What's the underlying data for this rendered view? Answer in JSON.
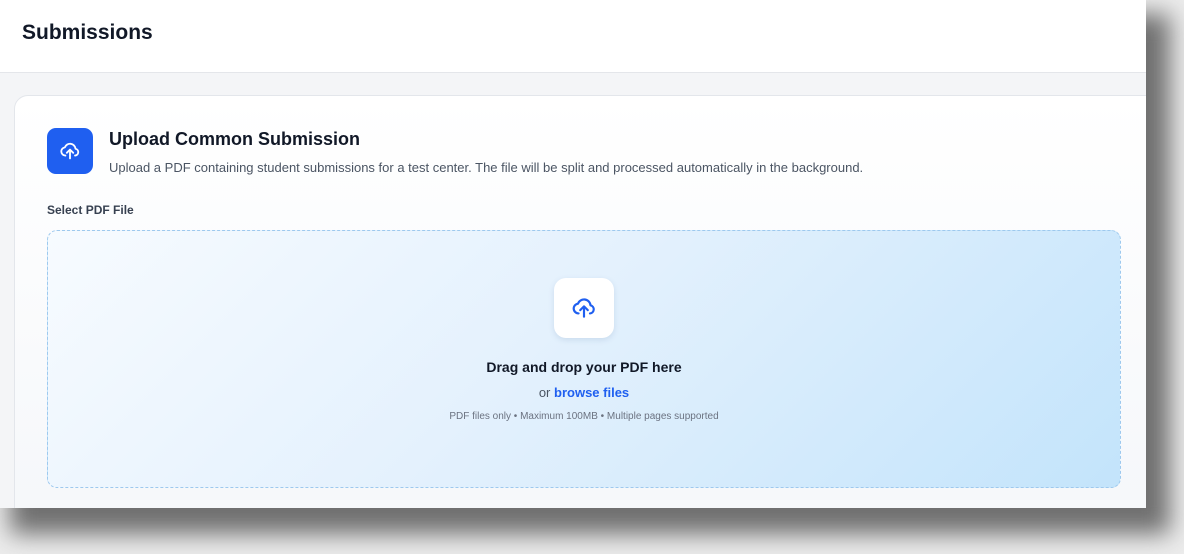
{
  "header": {
    "title": "Submissions"
  },
  "upload_card": {
    "title": "Upload Common Submission",
    "description": "Upload a PDF containing student submissions for a test center. The file will be split and processed automatically in the background.",
    "icon": "cloud-upload-icon"
  },
  "file_field": {
    "label": "Select PDF File"
  },
  "dropzone": {
    "icon": "cloud-upload-icon",
    "title": "Drag and drop your PDF here",
    "browse_prefix": "or",
    "browse_link": "browse files",
    "hint": "PDF files only • Maximum 100MB • Multiple pages supported"
  },
  "colors": {
    "accent": "#1f5ff0",
    "dropzone_border": "#9ec9ee",
    "title_text": "#111827"
  }
}
